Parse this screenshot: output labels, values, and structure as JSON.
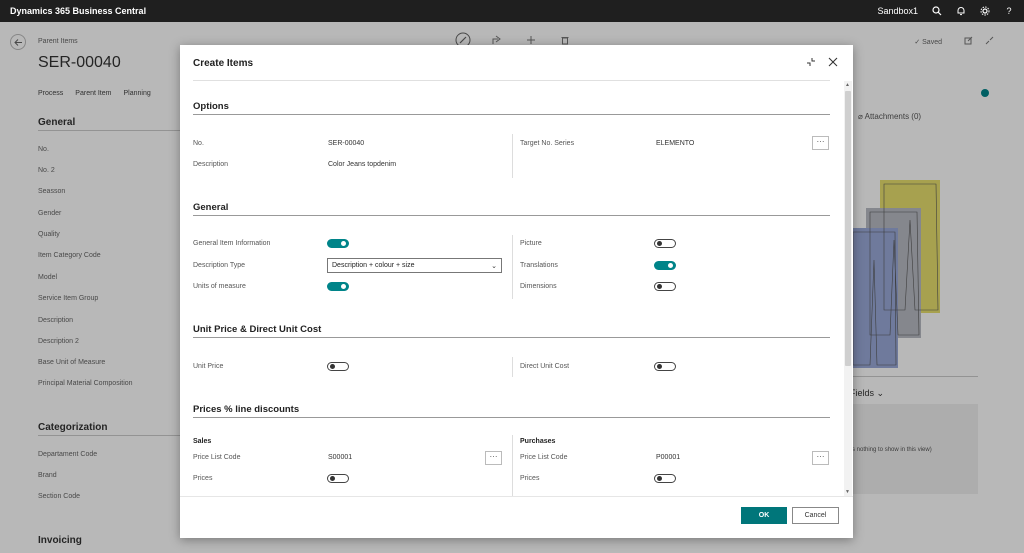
{
  "app": {
    "title": "Dynamics 365 Business Central",
    "environment": "Sandbox1"
  },
  "page": {
    "breadcrumb": "Parent Items",
    "record_title": "SER-00040",
    "saved_label": "✓ Saved",
    "actions": [
      "Process",
      "Parent Item",
      "Planning"
    ],
    "general_title": "General",
    "general_fields": [
      "No.",
      "No. 2",
      "Seasson",
      "Gender",
      "Quality",
      "Item Category Code",
      "Model",
      "Service Item Group",
      "Description",
      "Description 2",
      "Base Unit of Measure",
      "Principal Material Composition"
    ],
    "categorization_title": "Categorization",
    "categorization_fields": [
      "Departament Code",
      "Brand",
      "Section Code"
    ],
    "invoicing_title": "Invoicing",
    "attachments_label": "Attachments (0)",
    "fields_label": "Fields",
    "fields_note": "s nothing to show in this view)"
  },
  "dialog": {
    "title": "Create Items",
    "options": {
      "title": "Options",
      "no_label": "No.",
      "no_value": "SER-00040",
      "description_label": "Description",
      "description_value": "Color Jeans topdenim",
      "target_series_label": "Target No. Series",
      "target_series_value": "ELEMENTO",
      "ellipsis": "···"
    },
    "general": {
      "title": "General",
      "general_item_info_label": "General Item Information",
      "general_item_info_on": true,
      "description_type_label": "Description Type",
      "description_type_value": "Description + colour + size",
      "units_label": "Units of measure",
      "units_on": true,
      "picture_label": "Picture",
      "picture_on": false,
      "translations_label": "Translations",
      "translations_on": true,
      "dimensions_label": "Dimensions",
      "dimensions_on": false
    },
    "unit_price": {
      "title": "Unit Price & Direct Unit Cost",
      "unit_price_label": "Unit Price",
      "unit_price_on": false,
      "direct_cost_label": "Direct Unit Cost",
      "direct_cost_on": false
    },
    "prices": {
      "title": "Prices % line discounts",
      "sales_label": "Sales",
      "sales_price_list_label": "Price List Code",
      "sales_price_list_value": "S00001",
      "sales_prices_label": "Prices",
      "sales_prices_on": false,
      "purchases_label": "Purchases",
      "purch_price_list_label": "Price List Code",
      "purch_price_list_value": "P00001",
      "purch_prices_label": "Prices",
      "purch_prices_on": false
    },
    "ok_label": "OK",
    "cancel_label": "Cancel"
  },
  "colors": {
    "accent": "#008489",
    "ok_button": "#00767a",
    "topbar": "#1f1f1f"
  },
  "icons": [
    "back-arrow-icon",
    "search-icon",
    "bell-icon",
    "gear-icon",
    "help-icon",
    "edit-icon",
    "share-icon",
    "plus-icon",
    "delete-icon",
    "open-new-icon",
    "collapse-icon",
    "minimize-icon",
    "close-icon",
    "info-icon",
    "paperclip-icon"
  ]
}
